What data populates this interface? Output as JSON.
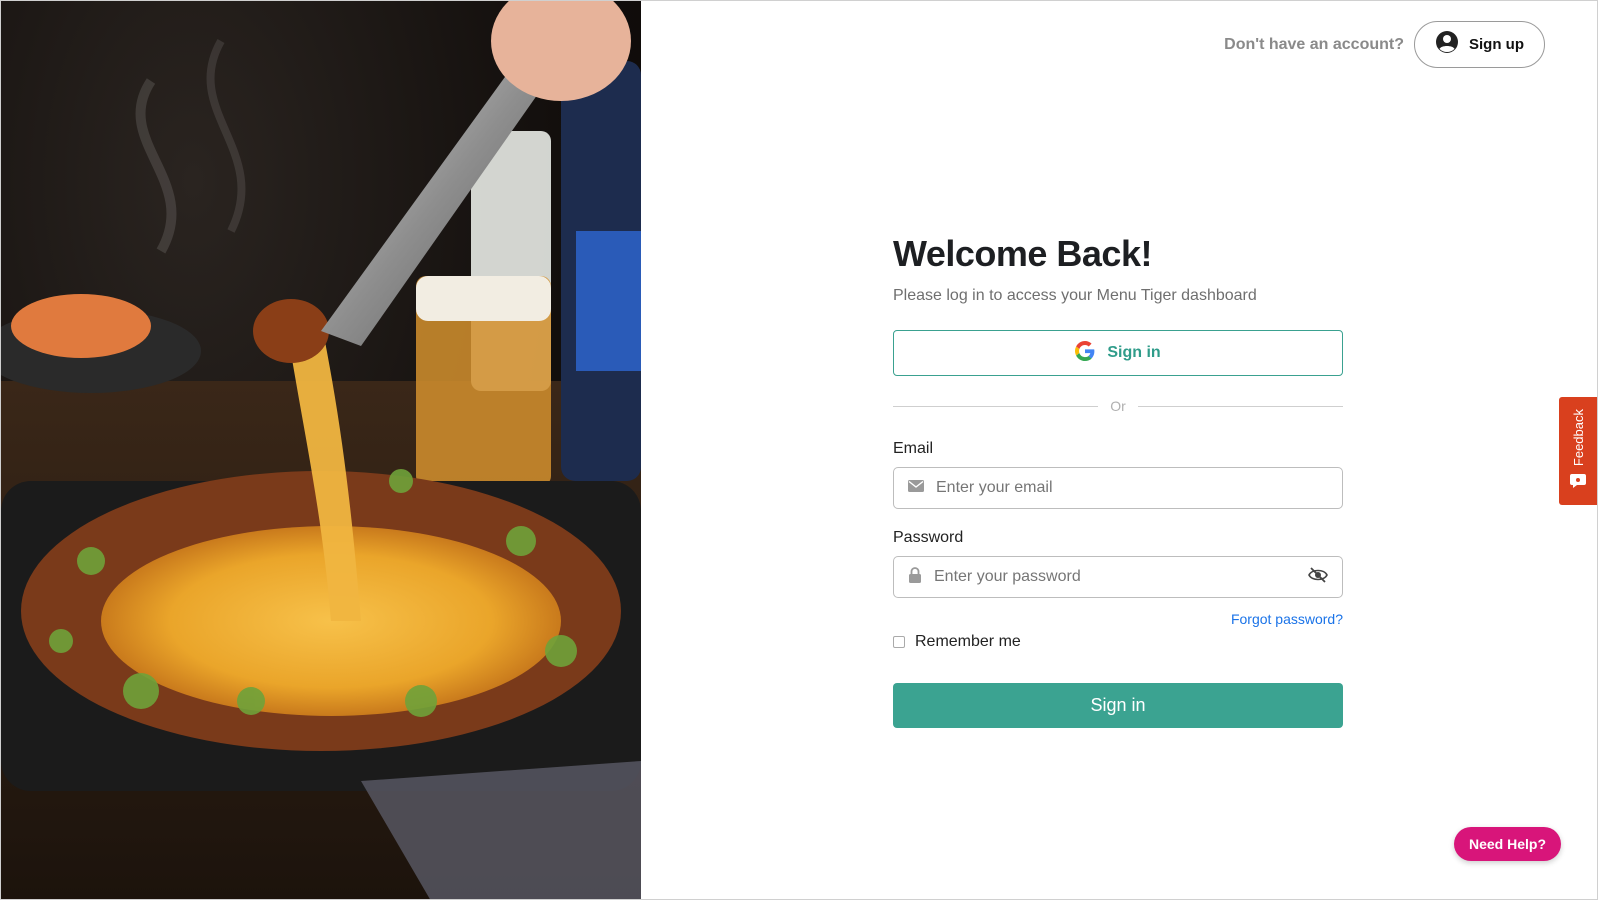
{
  "header": {
    "prompt": "Don't have an account?",
    "signup_label": "Sign up"
  },
  "form": {
    "title": "Welcome Back!",
    "subtitle": "Please log in to access your Menu Tiger dashboard",
    "google_label": "Sign in",
    "divider_text": "Or",
    "email_label": "Email",
    "email_placeholder": "Enter your email",
    "password_label": "Password",
    "password_placeholder": "Enter your password",
    "forgot_label": "Forgot password?",
    "remember_label": "Remember me",
    "submit_label": "Sign in"
  },
  "widgets": {
    "feedback_label": "Feedback",
    "help_label": "Need Help?"
  },
  "colors": {
    "primary": "#3ba391",
    "feedback": "#d9401e",
    "help": "#d8157a",
    "link": "#1a73e8"
  },
  "icons": [
    "user-circle-icon",
    "google-icon",
    "mail-icon",
    "lock-icon",
    "eye-off-icon",
    "chat-icon"
  ]
}
